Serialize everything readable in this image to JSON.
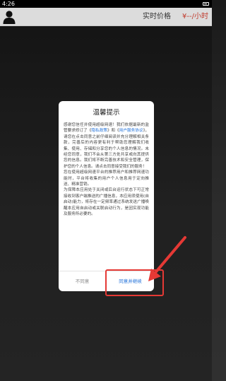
{
  "status_bar": {
    "time": "4:26"
  },
  "header": {
    "price_label": "实时价格",
    "price_value": "¥--/小时"
  },
  "dialog": {
    "title": "温馨提示",
    "body_part1": "感谢您信任并使用超级网速！我们依据最新的监管要求修订了《",
    "privacy_link": "隐私政策",
    "body_part2": "》和《",
    "terms_link": "用户服务协议",
    "body_part3": "》，请您在点击同意之前仔细阅读并充分理解相关条款，完善后的内容更有利于帮助您理解我们收集、使用、存储和分享您的个人信息的情况。未经您同意，我们不会从第三方处共享或向其提供您的信息。我们将不断完善技术和安全管理，保护您的个人信息。请点击同意接受我们的服务！\n您在使用超级网速平台的推荐用户和推荐网速功能时，平台将收集的用户个人信息用于定向推送、精准营销。\n为保障本应用处于关闭或后台运行状态下可正常接收到客户端推送的广播信息，本应用须使用(自启动)能力，将存在一定频率通过系统发送广播唤醒本应用自启动或关联启动行为，是因实现功能及服务所必要的。",
    "disagree_label": "不同意",
    "agree_label": "同意并继续"
  }
}
